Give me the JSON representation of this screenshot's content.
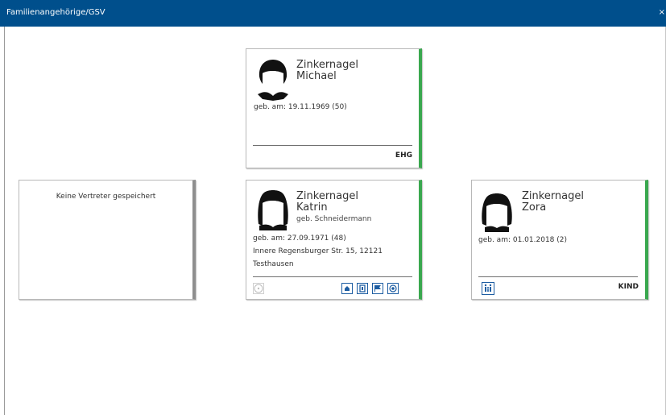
{
  "window": {
    "title": "Familienangehörige/GSV",
    "close_glyph": "×"
  },
  "spouse": {
    "surname": "Zinkernagel",
    "firstname": "Michael",
    "birth": "geb. am: 19.11.1969 (50)",
    "relation": "EHG"
  },
  "representatives": {
    "empty_text": "Keine Vertreter gespeichert"
  },
  "main_person": {
    "surname": "Zinkernagel",
    "firstname": "Katrin",
    "maiden": "geb. Schneidermann",
    "birth": "geb. am: 27.09.1971 (48)",
    "address_line1": "Innere Regensburger Str. 15, 12121",
    "address_line2": "Testhausen",
    "actions": [
      "add-circle-icon",
      "home-icon",
      "document-icon",
      "flag-icon",
      "target-icon"
    ]
  },
  "child": {
    "surname": "Zinkernagel",
    "firstname": "Zora",
    "birth": "geb. am: 01.01.2018 (2)",
    "relation": "KIND",
    "icon": "family-icon"
  },
  "colors": {
    "titlebar": "#004f8c",
    "accent": "#3aa84f",
    "icon_blue": "#1d5da2"
  }
}
